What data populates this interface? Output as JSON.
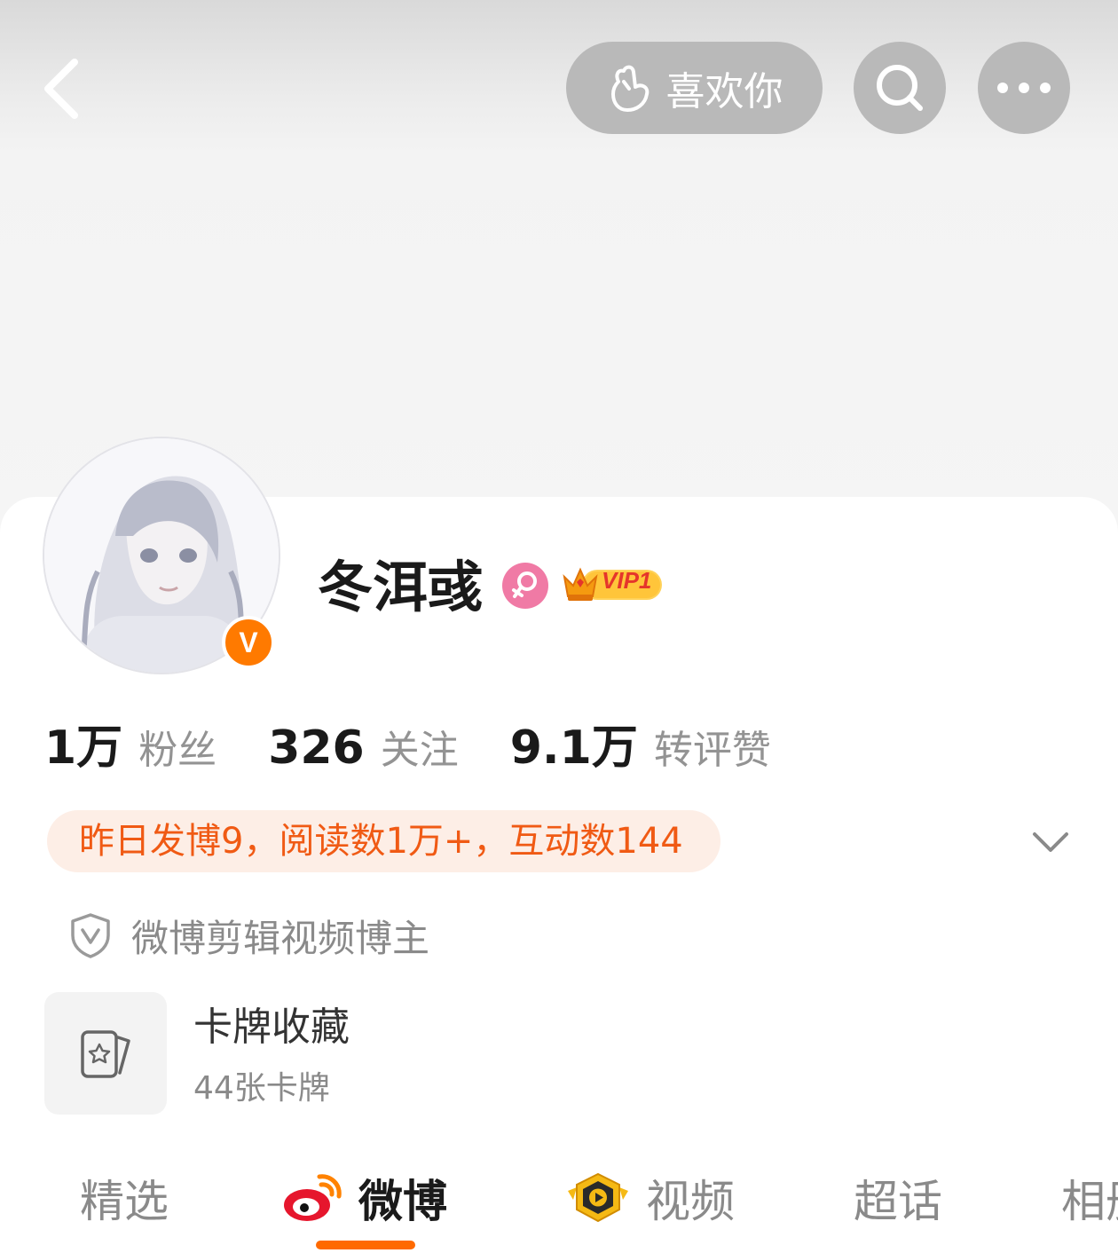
{
  "header": {
    "like_label": "喜欢你"
  },
  "profile": {
    "username": "冬洱彧",
    "vip_label": "VIP1",
    "verified_badge": "V"
  },
  "stats": [
    {
      "value": "1万",
      "label": "粉丝"
    },
    {
      "value": "326",
      "label": "关注"
    },
    {
      "value": "9.1万",
      "label": "转评赞"
    }
  ],
  "daily_summary": "昨日发博9，阅读数1万+，互动数144",
  "verification": {
    "text": "微博剪辑视频博主"
  },
  "card_collection": {
    "title": "卡牌收藏",
    "subtitle": "44张卡牌"
  },
  "tabs": [
    {
      "label": "精选"
    },
    {
      "label": "微博"
    },
    {
      "label": "视频"
    },
    {
      "label": "超话"
    },
    {
      "label": "相册"
    }
  ],
  "colors": {
    "accent": "#ff6a00",
    "summary_text": "#f05a14",
    "summary_bg": "#fdeee6",
    "female_badge": "#f07aa5"
  },
  "icons": {
    "back": "chevron-left-icon",
    "like": "hand-heart-icon",
    "search": "search-icon",
    "more": "more-dots-icon",
    "gender": "female-icon",
    "vip": "crown-icon",
    "expand": "chevron-down-icon",
    "verify": "shield-v-icon",
    "card": "card-star-icon",
    "weibo_tab": "weibo-logo-icon",
    "video_tab": "video-play-icon"
  }
}
